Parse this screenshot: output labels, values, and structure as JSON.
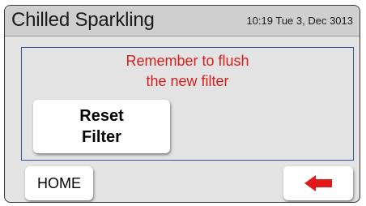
{
  "header": {
    "title": "Chilled Sparkling",
    "datetime": "10:19 Tue 3, Dec 3013"
  },
  "message": {
    "line1": "Remember to flush",
    "line2": "the new filter",
    "color": "#d42020"
  },
  "buttons": {
    "reset_line1": "Reset",
    "reset_line2": "Filter",
    "home_label": "HOME",
    "back_icon": "left-arrow-icon",
    "back_icon_color": "#e01818"
  }
}
